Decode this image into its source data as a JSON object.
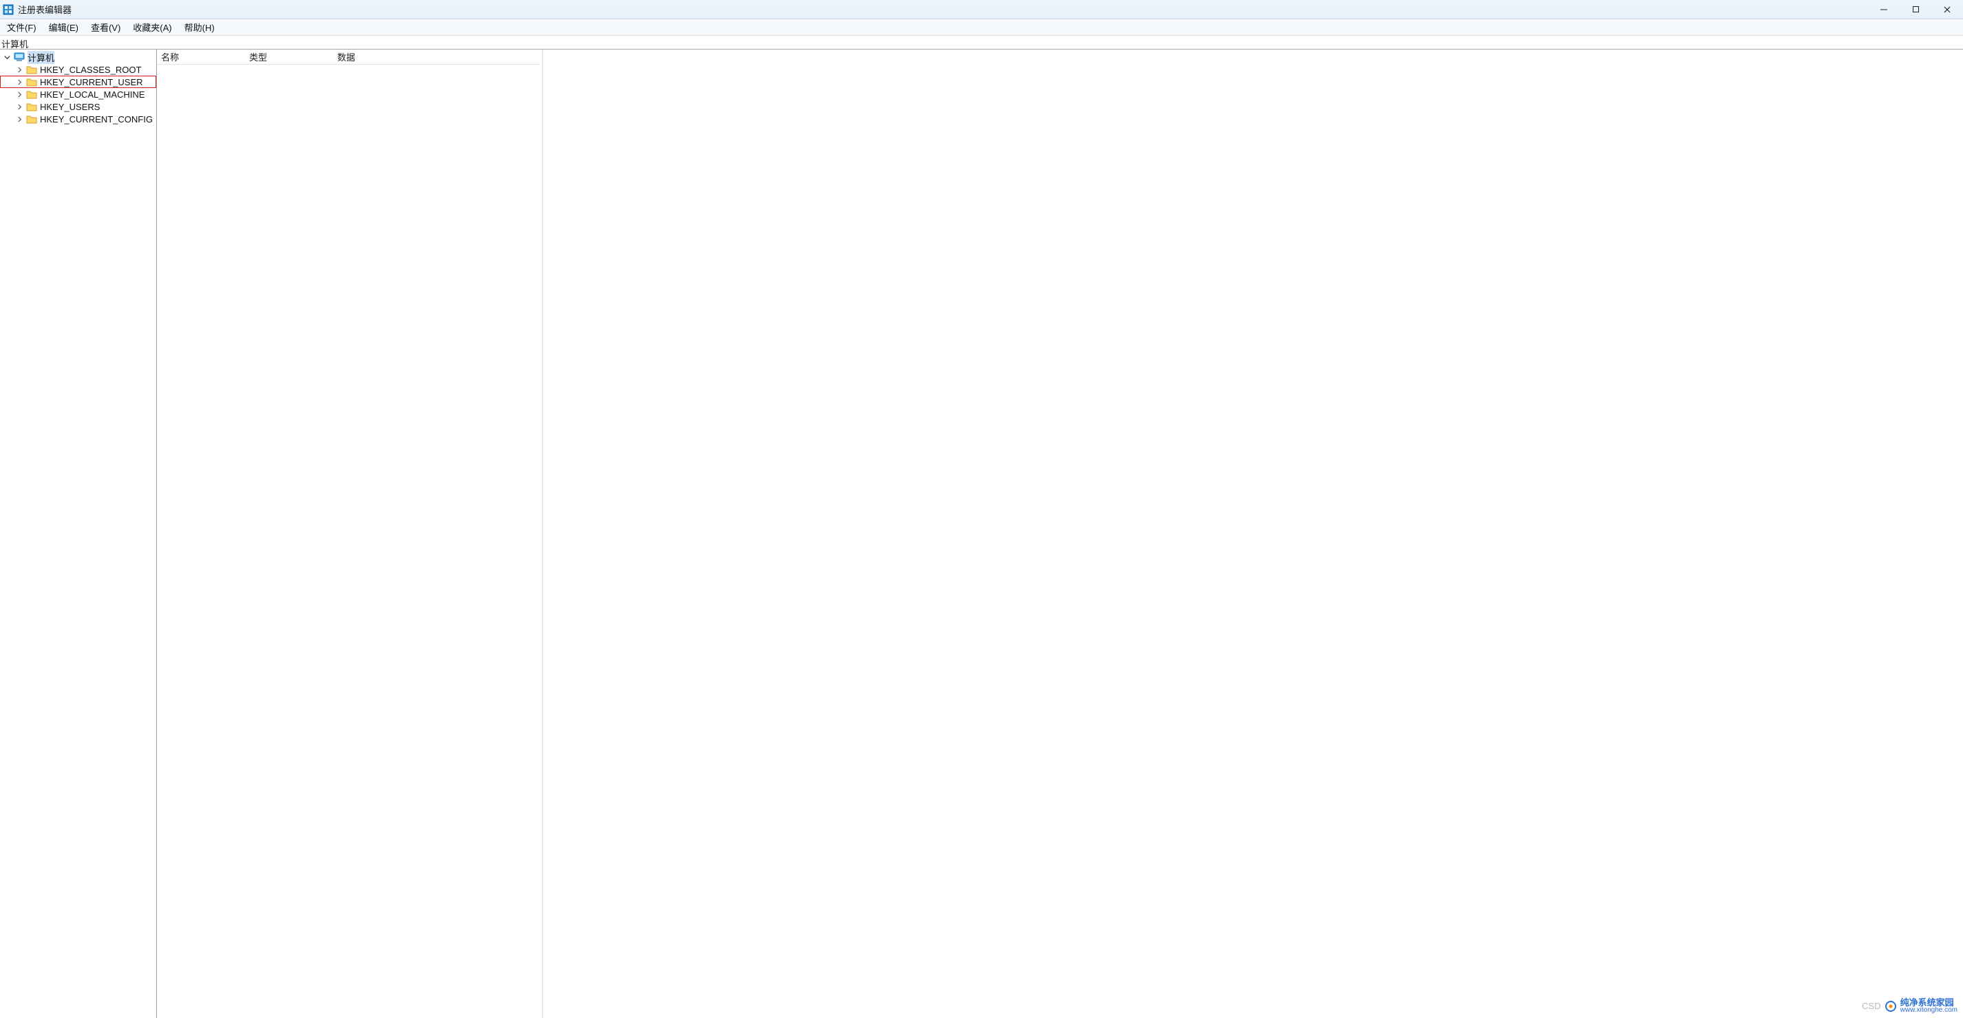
{
  "window": {
    "title": "注册表编辑器"
  },
  "menu": {
    "file": "文件(F)",
    "edit": "编辑(E)",
    "view": "查看(V)",
    "favorites": "收藏夹(A)",
    "help": "帮助(H)"
  },
  "address": "计算机",
  "tree": {
    "root": {
      "label": "计算机",
      "expanded": true
    },
    "hives": [
      {
        "label": "HKEY_CLASSES_ROOT",
        "highlighted": false
      },
      {
        "label": "HKEY_CURRENT_USER",
        "highlighted": true
      },
      {
        "label": "HKEY_LOCAL_MACHINE",
        "highlighted": false
      },
      {
        "label": "HKEY_USERS",
        "highlighted": false
      },
      {
        "label": "HKEY_CURRENT_CONFIG",
        "highlighted": false
      }
    ]
  },
  "list": {
    "columns": {
      "name": "名称",
      "type": "类型",
      "data": "数据"
    }
  },
  "watermark": {
    "left": "CSD",
    "brand": "纯净系统家园",
    "sub": "www.xitonghe.com"
  }
}
